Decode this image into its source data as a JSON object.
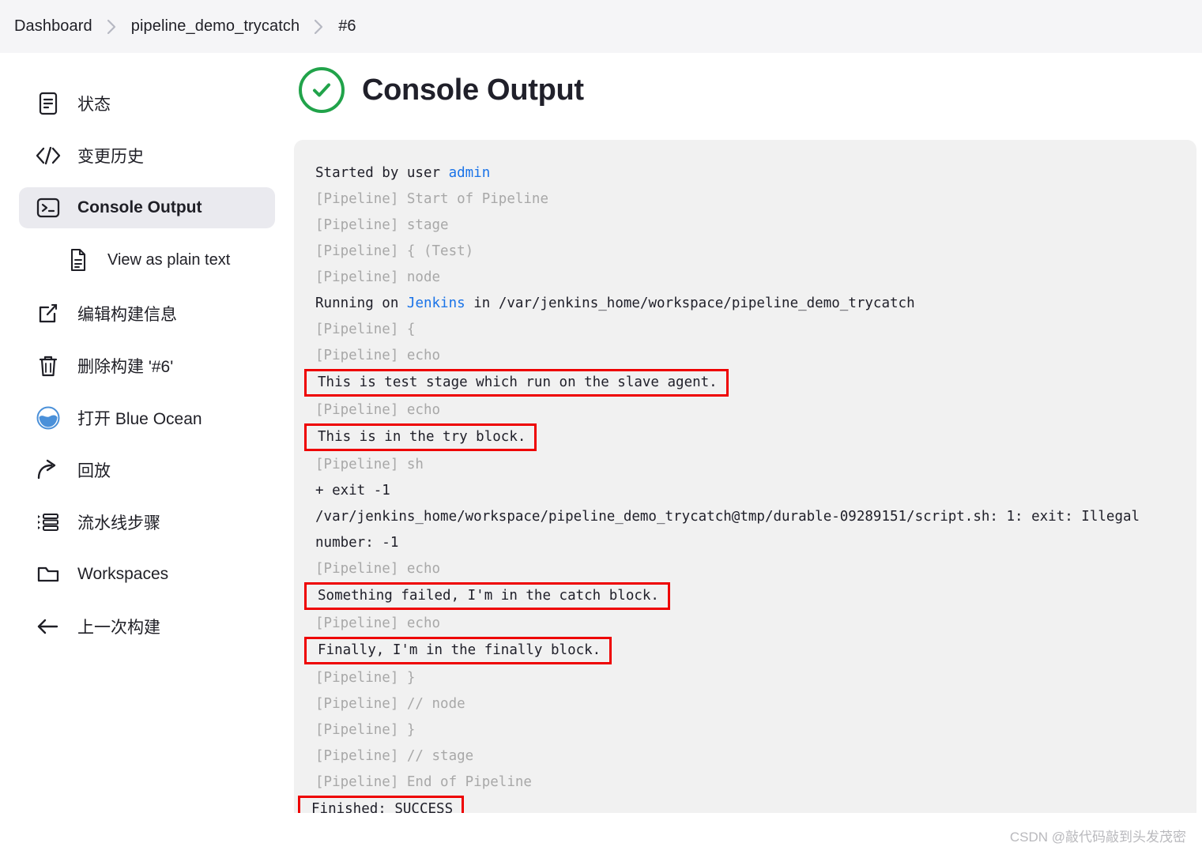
{
  "breadcrumb": {
    "items": [
      "Dashboard",
      "pipeline_demo_trycatch",
      "#6"
    ],
    "separator_icon": "chevron-right-icon"
  },
  "sidebar": {
    "items": [
      {
        "label": "状态",
        "icon": "document-status-icon",
        "active": false,
        "sub": false
      },
      {
        "label": "变更历史",
        "icon": "code-brackets-icon",
        "active": false,
        "sub": false
      },
      {
        "label": "Console Output",
        "icon": "terminal-icon",
        "active": true,
        "sub": false
      },
      {
        "label": "View as plain text",
        "icon": "plain-text-file-icon",
        "active": false,
        "sub": true
      },
      {
        "label": "编辑构建信息",
        "icon": "edit-square-icon",
        "active": false,
        "sub": false
      },
      {
        "label": "删除构建 '#6'",
        "icon": "trash-icon",
        "active": false,
        "sub": false
      },
      {
        "label": "打开 Blue Ocean",
        "icon": "blue-ocean-icon",
        "active": false,
        "sub": false
      },
      {
        "label": "回放",
        "icon": "replay-arrow-icon",
        "active": false,
        "sub": false
      },
      {
        "label": "流水线步骤",
        "icon": "pipeline-steps-icon",
        "active": false,
        "sub": false
      },
      {
        "label": "Workspaces",
        "icon": "folder-icon",
        "active": false,
        "sub": false
      },
      {
        "label": "上一次构建",
        "icon": "arrow-left-icon",
        "active": false,
        "sub": false
      }
    ]
  },
  "main": {
    "title": "Console Output",
    "status_icon": "success-check-circle-icon",
    "status_color": "#21a34a",
    "highlight_color": "#ee0000",
    "link_color": "#1a73e8",
    "console_lines": [
      {
        "text": "Started by user ",
        "link": "admin",
        "dim": false,
        "boxed": false
      },
      {
        "text": "[Pipeline] Start of Pipeline",
        "dim": true,
        "boxed": false
      },
      {
        "text": "[Pipeline] stage",
        "dim": true,
        "boxed": false
      },
      {
        "text": "[Pipeline] { (Test)",
        "dim": true,
        "boxed": false
      },
      {
        "text": "[Pipeline] node",
        "dim": true,
        "boxed": false
      },
      {
        "text": "Running on ",
        "link": "Jenkins",
        "text_after": " in /var/jenkins_home/workspace/pipeline_demo_trycatch",
        "dim": false,
        "boxed": false
      },
      {
        "text": "[Pipeline] {",
        "dim": true,
        "boxed": false
      },
      {
        "text": "[Pipeline] echo",
        "dim": true,
        "boxed": false
      },
      {
        "text": "This is test stage which run on the slave agent.",
        "dim": false,
        "boxed": true
      },
      {
        "text": "[Pipeline] echo",
        "dim": true,
        "boxed": false
      },
      {
        "text": "This is in the try block.",
        "dim": false,
        "boxed": true
      },
      {
        "text": "[Pipeline] sh",
        "dim": true,
        "boxed": false
      },
      {
        "text": "+ exit -1",
        "dim": false,
        "boxed": false
      },
      {
        "text": "/var/jenkins_home/workspace/pipeline_demo_trycatch@tmp/durable-09289151/script.sh: 1: exit: Illegal",
        "dim": false,
        "boxed": false
      },
      {
        "text": "number: -1",
        "dim": false,
        "boxed": false
      },
      {
        "text": "[Pipeline] echo",
        "dim": true,
        "boxed": false
      },
      {
        "text": "Something failed, I'm in the catch block.",
        "dim": false,
        "boxed": true
      },
      {
        "text": "[Pipeline] echo",
        "dim": true,
        "boxed": false
      },
      {
        "text": "Finally, I'm in the finally block.",
        "dim": false,
        "boxed": true
      },
      {
        "text": "[Pipeline] }",
        "dim": true,
        "boxed": false
      },
      {
        "text": "[Pipeline] // node",
        "dim": true,
        "boxed": false
      },
      {
        "text": "[Pipeline] }",
        "dim": true,
        "boxed": false
      },
      {
        "text": "[Pipeline] // stage",
        "dim": true,
        "boxed": false
      },
      {
        "text": "[Pipeline] End of Pipeline",
        "dim": true,
        "boxed": false
      },
      {
        "text": "Finished: SUCCESS",
        "dim": false,
        "boxed": true,
        "finish": true
      }
    ]
  },
  "watermark": "CSDN @敲代码敲到头发茂密"
}
